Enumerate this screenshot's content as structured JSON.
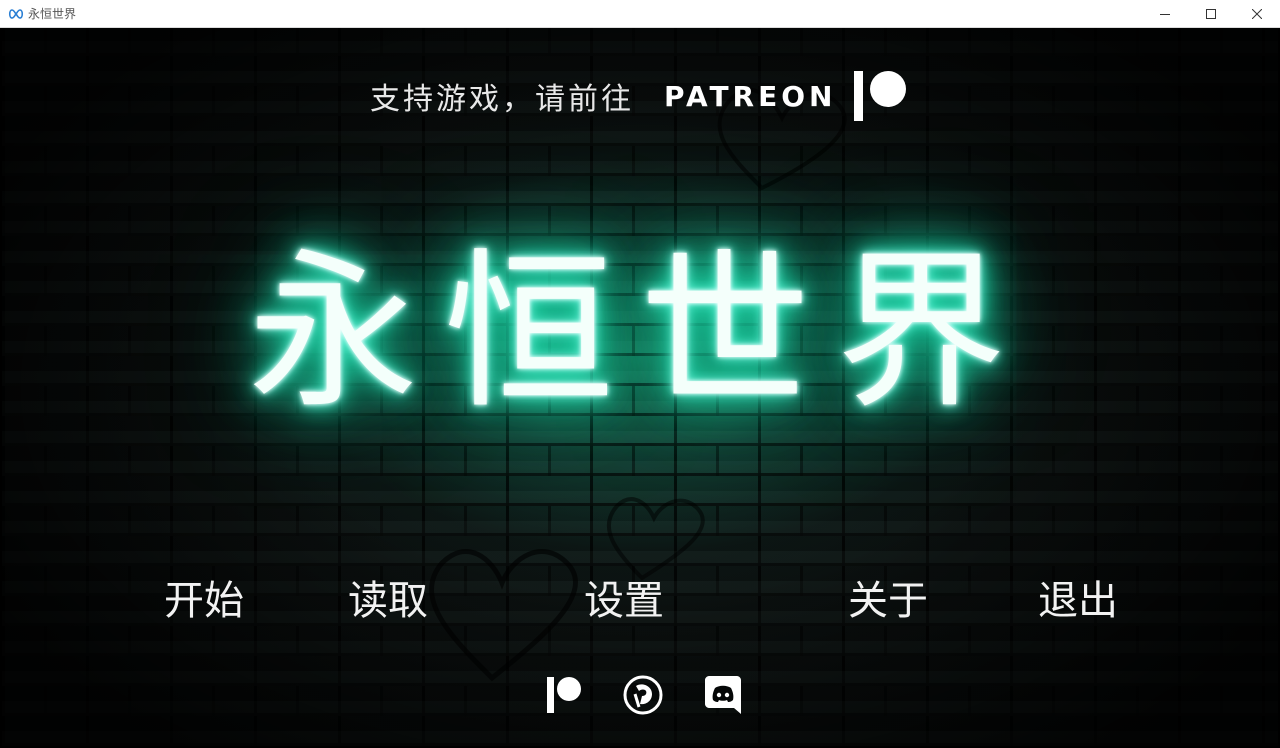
{
  "window": {
    "title": "永恒世界",
    "icons": {
      "app": "infinity-icon",
      "minimize": "minimize-icon",
      "maximize": "maximize-icon",
      "close": "close-icon"
    }
  },
  "game": {
    "support_text": "支持游戏，请前往",
    "patreon_word": "PATREON",
    "title": "永恒世界",
    "accent_color": "#18d7a6",
    "menu": [
      {
        "label": "开始"
      },
      {
        "label": "读取"
      },
      {
        "label": "设置"
      },
      {
        "label": "关于"
      },
      {
        "label": "退出"
      }
    ],
    "social": [
      {
        "icon": "patreon-icon"
      },
      {
        "icon": "renpy-icon"
      },
      {
        "icon": "discord-icon"
      }
    ]
  }
}
